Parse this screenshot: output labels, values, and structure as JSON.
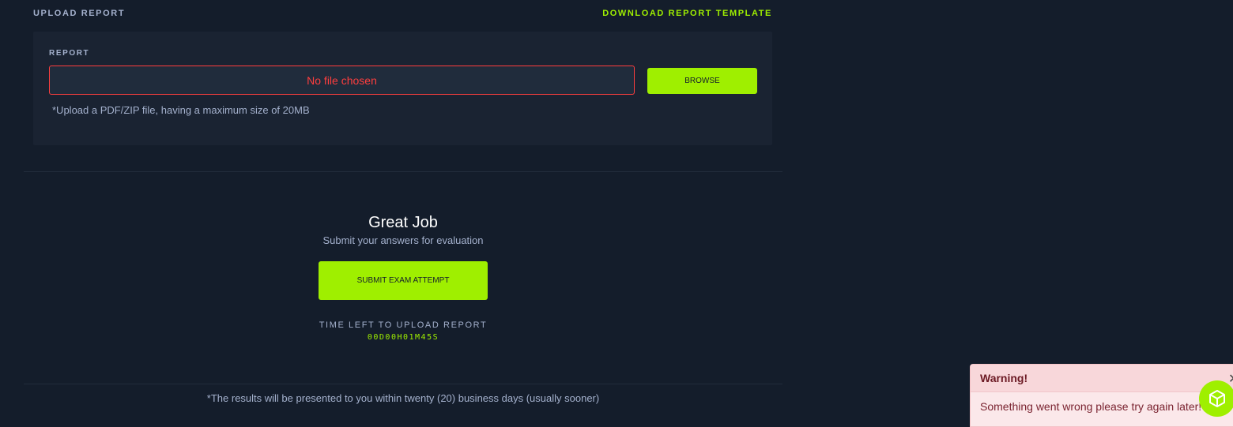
{
  "upload": {
    "section_title": "UPLOAD REPORT",
    "template_link": "DOWNLOAD REPORT TEMPLATE",
    "field_label": "REPORT",
    "file_input_text": "No file chosen",
    "browse_label": "BROWSE",
    "help_text": "*Upload a PDF/ZIP file, having a maximum size of 20MB"
  },
  "submit": {
    "heading": "Great Job",
    "subheading": "Submit your answers for evaluation",
    "button_label": "SUBMIT EXAM ATTEMPT",
    "time_label": "TIME LEFT TO UPLOAD REPORT",
    "time_value": "00D00H01M45S"
  },
  "footer": {
    "results_note": "*The results will be presented to you within twenty (20) business days (usually sooner)"
  },
  "toast": {
    "title": "Warning!",
    "message": "Something went wrong please try again later!",
    "close_glyph": "✕"
  },
  "colors": {
    "background": "#141d2b",
    "card": "#1a2332",
    "accent": "#9fef00",
    "error": "#ff3e3e",
    "toast_bg": "#fbe8ea"
  },
  "icons": {
    "fab": "cube-icon",
    "close": "close-icon"
  }
}
